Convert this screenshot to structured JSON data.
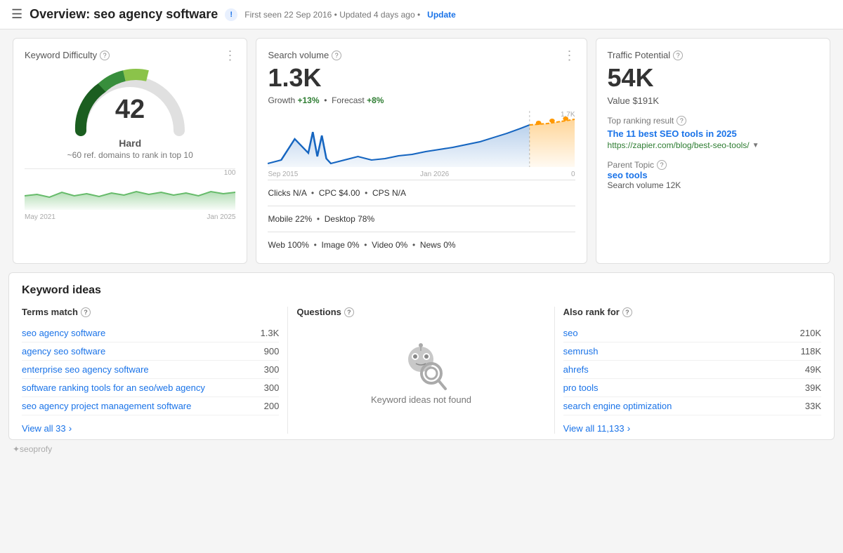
{
  "header": {
    "menu_label": "☰",
    "title": "Overview: seo agency software",
    "info_badge": "!",
    "meta": "First seen 22 Sep 2016 • Updated 4 days ago •",
    "update_label": "Update"
  },
  "keyword_difficulty": {
    "title": "Keyword Difficulty",
    "more": "⋮",
    "value": "42",
    "label": "Hard",
    "sublabel": "~60 ref. domains to rank in top 10",
    "chart_label_left": "May 2021",
    "chart_label_right": "Jan 2025",
    "chart_max": "100"
  },
  "search_volume": {
    "title": "Search volume",
    "more": "⋮",
    "value": "1.3K",
    "growth_label": "Growth",
    "growth_value": "+13%",
    "forecast_label": "Forecast",
    "forecast_value": "+8%",
    "chart_label_left": "Sep 2015",
    "chart_label_right": "Jan 2026",
    "chart_max": "1.7K",
    "chart_min": "0",
    "clicks_label": "Clicks",
    "clicks_value": "N/A",
    "cpc_label": "CPC",
    "cpc_value": "$4.00",
    "cps_label": "CPS",
    "cps_value": "N/A",
    "mobile_label": "Mobile",
    "mobile_value": "22%",
    "desktop_label": "Desktop",
    "desktop_value": "78%",
    "web_label": "Web",
    "web_value": "100%",
    "image_label": "Image",
    "image_value": "0%",
    "video_label": "Video",
    "video_value": "0%",
    "news_label": "News",
    "news_value": "0%"
  },
  "traffic_potential": {
    "title": "Traffic Potential",
    "value": "54K",
    "value_label": "Value",
    "value_amount": "$191K",
    "top_ranking_label": "Top ranking result",
    "top_ranking_title": "The 11 best SEO tools in 2025",
    "top_ranking_url": "https://zapier.com/blog/best-seo-tools/",
    "parent_topic_label": "Parent Topic",
    "parent_topic_keyword": "seo tools",
    "parent_topic_search_vol_label": "Search volume",
    "parent_topic_search_vol": "12K"
  },
  "keyword_ideas": {
    "section_title": "Keyword ideas",
    "terms_match": {
      "title": "Terms match",
      "items": [
        {
          "keyword": "seo agency software",
          "volume": "1.3K"
        },
        {
          "keyword": "agency seo software",
          "volume": "900"
        },
        {
          "keyword": "enterprise seo agency software",
          "volume": "300"
        },
        {
          "keyword": "software ranking tools for an seo/web agency",
          "volume": "300"
        },
        {
          "keyword": "seo agency project management software",
          "volume": "200"
        }
      ],
      "view_all_label": "View all 33",
      "chevron": "›"
    },
    "questions": {
      "title": "Questions",
      "empty_text": "Keyword ideas not found"
    },
    "also_rank_for": {
      "title": "Also rank for",
      "items": [
        {
          "keyword": "seo",
          "volume": "210K"
        },
        {
          "keyword": "semrush",
          "volume": "118K"
        },
        {
          "keyword": "ahrefs",
          "volume": "49K"
        },
        {
          "keyword": "pro tools",
          "volume": "39K"
        },
        {
          "keyword": "search engine optimization",
          "volume": "33K"
        }
      ],
      "view_all_label": "View all 11,133",
      "chevron": "›"
    }
  },
  "footer": {
    "logo": "✦seoprofy"
  },
  "colors": {
    "blue_link": "#1a73e8",
    "green": "#2e7d32",
    "green_light": "#4caf50",
    "gauge_green_dark": "#1b5e20",
    "gauge_yellow_green": "#8bc34a",
    "orange": "#ff9800"
  }
}
